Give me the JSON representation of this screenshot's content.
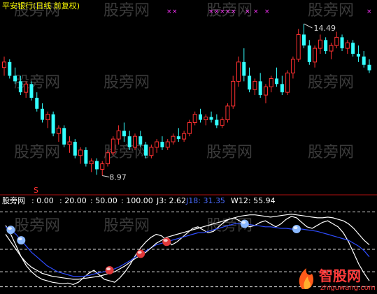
{
  "window": {
    "title": "平安银行(日线 前复权)"
  },
  "indicator_header": {
    "name": "股旁网",
    "levels": [
      ": 0.00",
      ": 20.00",
      ": 50.00",
      ": 100.00"
    ],
    "j3": "J3: 2.62",
    "j18": "J18: 31.35",
    "w12": "W12: 55.94"
  },
  "watermarks": [
    "股旁网",
    "股旁网",
    "股旁网",
    "股旁网",
    "股旁网",
    "股旁网",
    "股旁网",
    "股旁网",
    "股旁网",
    "股旁网",
    "股旁网"
  ],
  "logo": {
    "name": "智股网",
    "url": "zhiguwang.com"
  },
  "colors": {
    "up": "#ff3030",
    "down": "#33ffff",
    "j18_line": "#2e4cff",
    "white_line": "#ffffff",
    "marker_magenta": "#ff33ff",
    "dot_red": "#e0383a",
    "dot_blue": "#8ab8ff"
  },
  "chart_data": [
    {
      "type": "candlestick",
      "title": "平安银行(日线 前复权)",
      "high_annotation": "14.49",
      "low_annotation": "8.97",
      "y_range": [
        8.5,
        15.0
      ],
      "candles": [
        [
          12.9,
          13.3,
          12.6,
          13.1
        ],
        [
          13.1,
          13.2,
          12.5,
          12.6
        ],
        [
          12.6,
          12.9,
          12.3,
          12.4
        ],
        [
          12.4,
          12.6,
          11.9,
          12.0
        ],
        [
          12.0,
          12.4,
          11.8,
          12.3
        ],
        [
          12.3,
          12.4,
          11.7,
          11.8
        ],
        [
          11.8,
          12.0,
          11.3,
          11.4
        ],
        [
          11.4,
          11.6,
          10.9,
          11.0
        ],
        [
          11.0,
          11.3,
          10.7,
          11.2
        ],
        [
          11.2,
          11.3,
          10.4,
          10.5
        ],
        [
          10.5,
          10.8,
          10.2,
          10.7
        ],
        [
          10.7,
          10.8,
          10.0,
          10.1
        ],
        [
          10.1,
          10.4,
          9.8,
          10.2
        ],
        [
          10.2,
          10.3,
          9.6,
          9.7
        ],
        [
          9.7,
          10.0,
          9.4,
          9.9
        ],
        [
          9.9,
          10.0,
          9.3,
          9.4
        ],
        [
          9.4,
          9.6,
          9.1,
          9.5
        ],
        [
          9.5,
          9.6,
          9.0,
          9.2
        ],
        [
          9.2,
          9.5,
          8.97,
          9.4
        ],
        [
          9.4,
          9.9,
          9.3,
          9.8
        ],
        [
          9.8,
          10.4,
          9.7,
          10.3
        ],
        [
          10.3,
          10.8,
          10.1,
          10.6
        ],
        [
          10.6,
          10.9,
          10.2,
          10.4
        ],
        [
          10.4,
          10.6,
          9.9,
          10.0
        ],
        [
          10.0,
          10.5,
          9.9,
          10.4
        ],
        [
          10.4,
          10.6,
          10.0,
          10.1
        ],
        [
          10.1,
          10.2,
          9.6,
          9.7
        ],
        [
          9.7,
          10.1,
          9.6,
          10.0
        ],
        [
          10.0,
          10.3,
          9.8,
          10.2
        ],
        [
          10.2,
          10.4,
          9.9,
          10.0
        ],
        [
          10.0,
          10.3,
          9.9,
          10.2
        ],
        [
          10.2,
          10.5,
          10.1,
          10.4
        ],
        [
          10.4,
          10.7,
          10.2,
          10.3
        ],
        [
          10.3,
          10.6,
          10.2,
          10.5
        ],
        [
          10.5,
          11.0,
          10.4,
          10.9
        ],
        [
          10.9,
          11.3,
          10.8,
          11.2
        ],
        [
          11.2,
          11.4,
          10.9,
          11.0
        ],
        [
          11.0,
          11.2,
          10.8,
          11.1
        ],
        [
          11.1,
          11.3,
          10.9,
          11.0
        ],
        [
          11.0,
          11.2,
          10.7,
          10.8
        ],
        [
          10.8,
          11.1,
          10.7,
          11.0
        ],
        [
          11.0,
          11.6,
          10.9,
          11.5
        ],
        [
          11.5,
          12.6,
          11.4,
          12.4
        ],
        [
          12.4,
          13.3,
          12.2,
          13.1
        ],
        [
          13.1,
          13.6,
          12.4,
          12.6
        ],
        [
          12.6,
          12.9,
          12.0,
          12.1
        ],
        [
          12.1,
          12.5,
          11.9,
          12.4
        ],
        [
          12.4,
          12.7,
          11.8,
          11.9
        ],
        [
          11.9,
          12.3,
          11.6,
          12.2
        ],
        [
          12.2,
          12.6,
          12.0,
          12.5
        ],
        [
          12.5,
          12.9,
          12.2,
          12.3
        ],
        [
          12.3,
          12.6,
          11.9,
          12.0
        ],
        [
          12.0,
          12.8,
          11.9,
          12.7
        ],
        [
          12.7,
          13.3,
          12.5,
          13.2
        ],
        [
          13.2,
          14.3,
          13.1,
          14.1
        ],
        [
          14.1,
          14.49,
          13.6,
          13.7
        ],
        [
          13.7,
          13.9,
          13.0,
          13.1
        ],
        [
          13.1,
          13.7,
          12.9,
          13.6
        ],
        [
          13.6,
          14.1,
          13.4,
          13.9
        ],
        [
          13.9,
          14.0,
          13.4,
          13.5
        ],
        [
          13.5,
          13.8,
          13.2,
          13.7
        ],
        [
          13.7,
          14.2,
          13.6,
          14.0
        ],
        [
          14.0,
          14.1,
          13.5,
          13.6
        ],
        [
          13.6,
          13.9,
          13.4,
          13.8
        ],
        [
          13.8,
          13.9,
          13.3,
          13.4
        ],
        [
          13.4,
          13.7,
          13.1,
          13.3
        ],
        [
          13.3,
          13.5,
          12.9,
          13.0
        ],
        [
          13.0,
          13.2,
          12.7,
          12.8
        ]
      ],
      "signal_markers": "magenta x markers along the top border",
      "bottom_marker": "S"
    },
    {
      "type": "line",
      "title": "股旁网",
      "levels": [
        0,
        20,
        50,
        100
      ],
      "y_range": [
        -5,
        105
      ],
      "series": [
        {
          "name": "J3",
          "color": "white",
          "values": [
            82,
            70,
            55,
            40,
            28,
            20,
            14,
            10,
            8,
            6,
            5,
            4,
            5,
            3,
            6,
            12,
            18,
            22,
            16,
            10,
            8,
            6,
            12,
            20,
            30,
            42,
            52,
            60,
            66,
            70,
            68,
            62,
            56,
            60,
            66,
            72,
            78,
            80,
            76,
            72,
            74,
            80,
            86,
            90,
            92,
            88,
            84,
            80,
            82,
            86,
            88,
            84,
            80,
            84,
            90,
            94,
            92,
            86,
            80,
            78,
            82,
            86,
            88,
            84,
            80,
            72,
            60,
            45,
            30,
            18,
            8
          ]
        },
        {
          "name": "J18",
          "color": "blue",
          "values": [
            80,
            76,
            70,
            62,
            54,
            46,
            40,
            34,
            28,
            24,
            20,
            18,
            16,
            14,
            14,
            14,
            15,
            17,
            19,
            20,
            22,
            24,
            27,
            31,
            35,
            40,
            44,
            48,
            52,
            56,
            58,
            60,
            62,
            64,
            66,
            68,
            70,
            72,
            72,
            74,
            76,
            78,
            80,
            82,
            84,
            84,
            84,
            83,
            82,
            81,
            80,
            80,
            79,
            78,
            78,
            77,
            77,
            77,
            76,
            75,
            74,
            72,
            70,
            68,
            66,
            64,
            62,
            58,
            54,
            48,
            40
          ]
        },
        {
          "name": "W12",
          "color": "white",
          "values": [
            70,
            60,
            50,
            40,
            32,
            26,
            22,
            18,
            16,
            14,
            13,
            12,
            11,
            10,
            10,
            11,
            12,
            13,
            14,
            16,
            18,
            20,
            24,
            28,
            33,
            38,
            42,
            46,
            52,
            58,
            62,
            66,
            68,
            70,
            72,
            74,
            76,
            78,
            80,
            82,
            84,
            86,
            88,
            90,
            92,
            94,
            95,
            96,
            96,
            95,
            94,
            93,
            94,
            95,
            96,
            97,
            96,
            95,
            94,
            93,
            92,
            92,
            93,
            92,
            90,
            88,
            84,
            78,
            70,
            62,
            56
          ]
        }
      ],
      "signal_dots": [
        {
          "index": 1,
          "kind": "blue"
        },
        {
          "index": 3,
          "kind": "blue"
        },
        {
          "index": 20,
          "kind": "red"
        },
        {
          "index": 26,
          "kind": "red"
        },
        {
          "index": 31,
          "kind": "red"
        },
        {
          "index": 46,
          "kind": "blue"
        },
        {
          "index": 56,
          "kind": "blue"
        }
      ]
    }
  ]
}
